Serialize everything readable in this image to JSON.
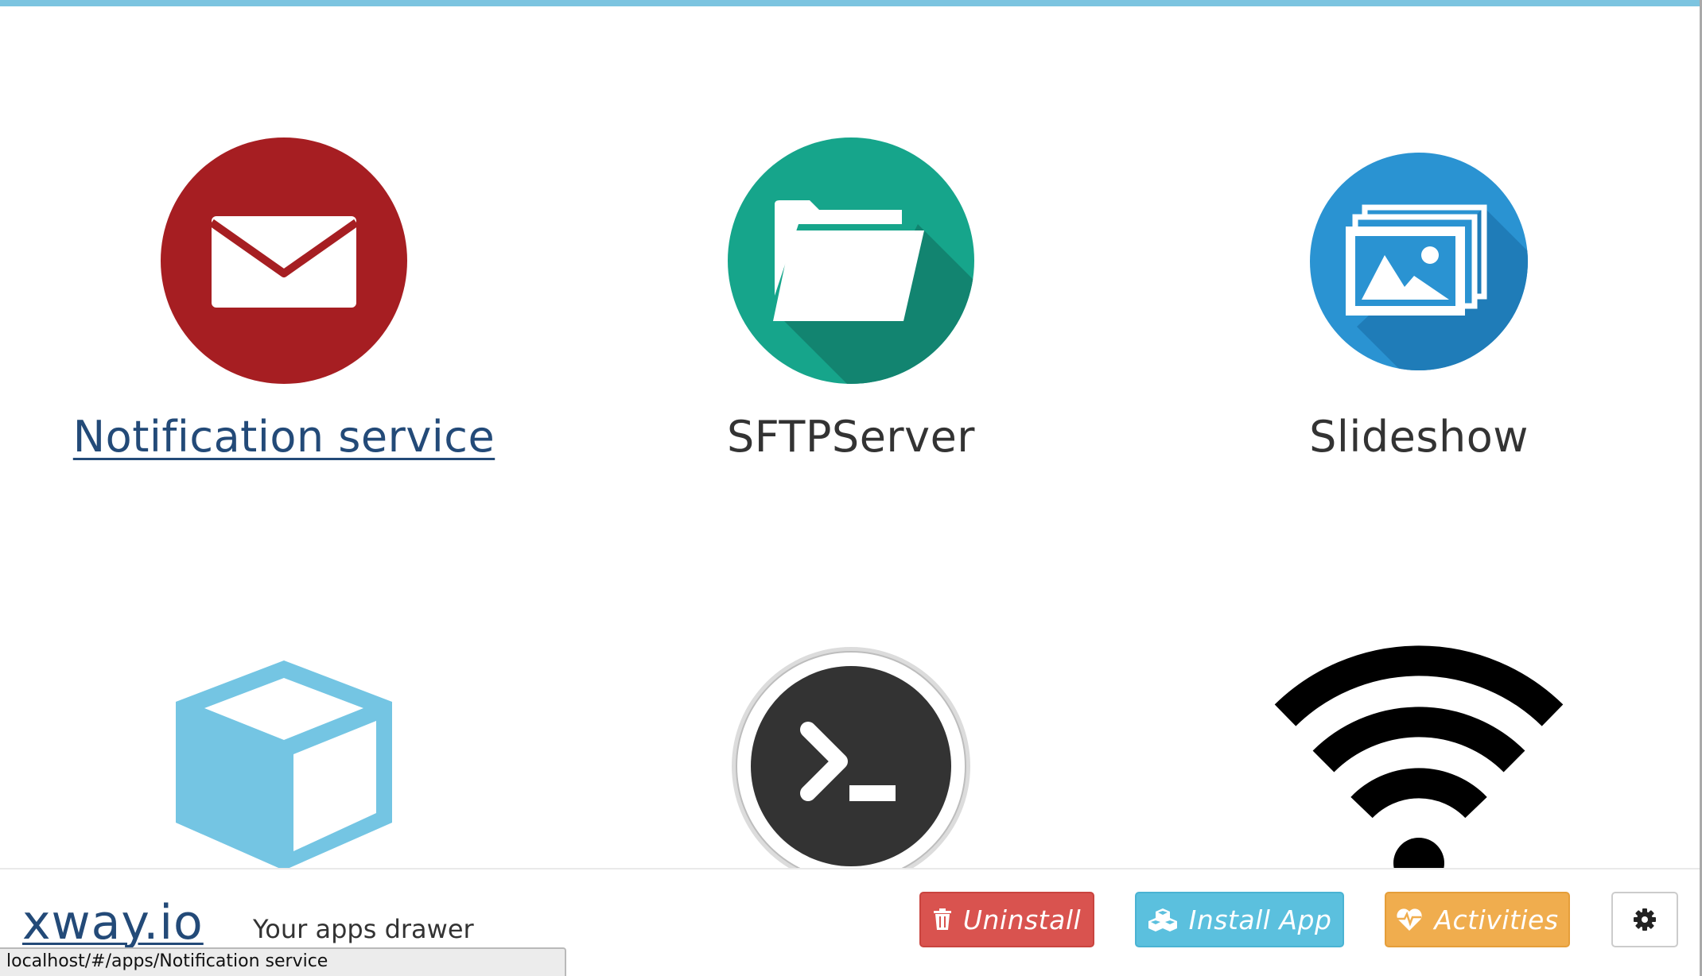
{
  "apps": [
    {
      "name": "Notification service",
      "icon": "envelope-icon",
      "color": "#a61e22",
      "hovered": true
    },
    {
      "name": "SFTPServer",
      "icon": "folder-open-icon",
      "color": "#16a58b"
    },
    {
      "name": "Slideshow",
      "icon": "image-gallery-icon",
      "color": "#2a93d2"
    },
    {
      "name": "",
      "icon": "cube-icon",
      "color": "#74c5e3"
    },
    {
      "name": "",
      "icon": "terminal-icon",
      "color": "#333333"
    },
    {
      "name": "",
      "icon": "wifi-icon",
      "color": "#000000"
    }
  ],
  "footer": {
    "brand": "xway.io",
    "tagline": "Your apps drawer",
    "uninstall_label": "Uninstall",
    "install_label": "Install App",
    "activities_label": "Activities",
    "settings_icon": "gear-icon"
  },
  "status_bar": {
    "url": "localhost/#/apps/Notification service"
  },
  "colors": {
    "accent_strip": "#7cc4e0",
    "link": "#234a78",
    "danger": "#d9534f",
    "info": "#5bc0de",
    "warning": "#f0ad4e"
  }
}
